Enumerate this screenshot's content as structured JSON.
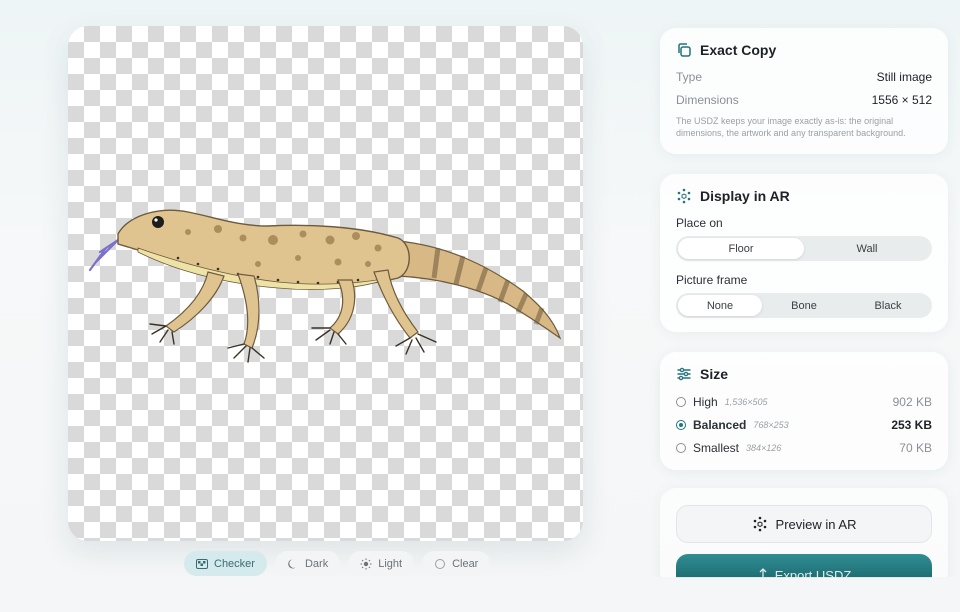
{
  "background_options": [
    {
      "label": "Checker",
      "icon": "checker-icon",
      "active": true
    },
    {
      "label": "Dark",
      "icon": "moon-icon",
      "active": false
    },
    {
      "label": "Light",
      "icon": "sun-icon",
      "active": false
    },
    {
      "label": "Clear",
      "icon": "circle-icon",
      "active": false
    }
  ],
  "exact_copy": {
    "title": "Exact Copy",
    "type_label": "Type",
    "type_value": "Still image",
    "dimensions_label": "Dimensions",
    "dimensions_value": "1556 × 512",
    "note": "The USDZ keeps your image exactly as-is: the original dimensions, the artwork and any transparent background."
  },
  "display_ar": {
    "title": "Display in AR",
    "place_on_label": "Place on",
    "place_on_options": [
      "Floor",
      "Wall"
    ],
    "place_on_selected": "Floor",
    "frame_label": "Picture frame",
    "frame_options": [
      "None",
      "Bone",
      "Black"
    ],
    "frame_selected": "None"
  },
  "size": {
    "title": "Size",
    "options": [
      {
        "name": "High",
        "dims": "1,536×505",
        "kb": "902 KB",
        "selected": false
      },
      {
        "name": "Balanced",
        "dims": "768×253",
        "kb": "253 KB",
        "selected": true
      },
      {
        "name": "Smallest",
        "dims": "384×126",
        "kb": "70 KB",
        "selected": false
      }
    ]
  },
  "actions": {
    "preview_label": "Preview in AR",
    "export_label": "Export USDZ"
  },
  "colors": {
    "accent": "#23747c",
    "export_top": "#2f8e93",
    "export_bottom": "#1f6e74",
    "active_chip": "#d4eaec"
  }
}
